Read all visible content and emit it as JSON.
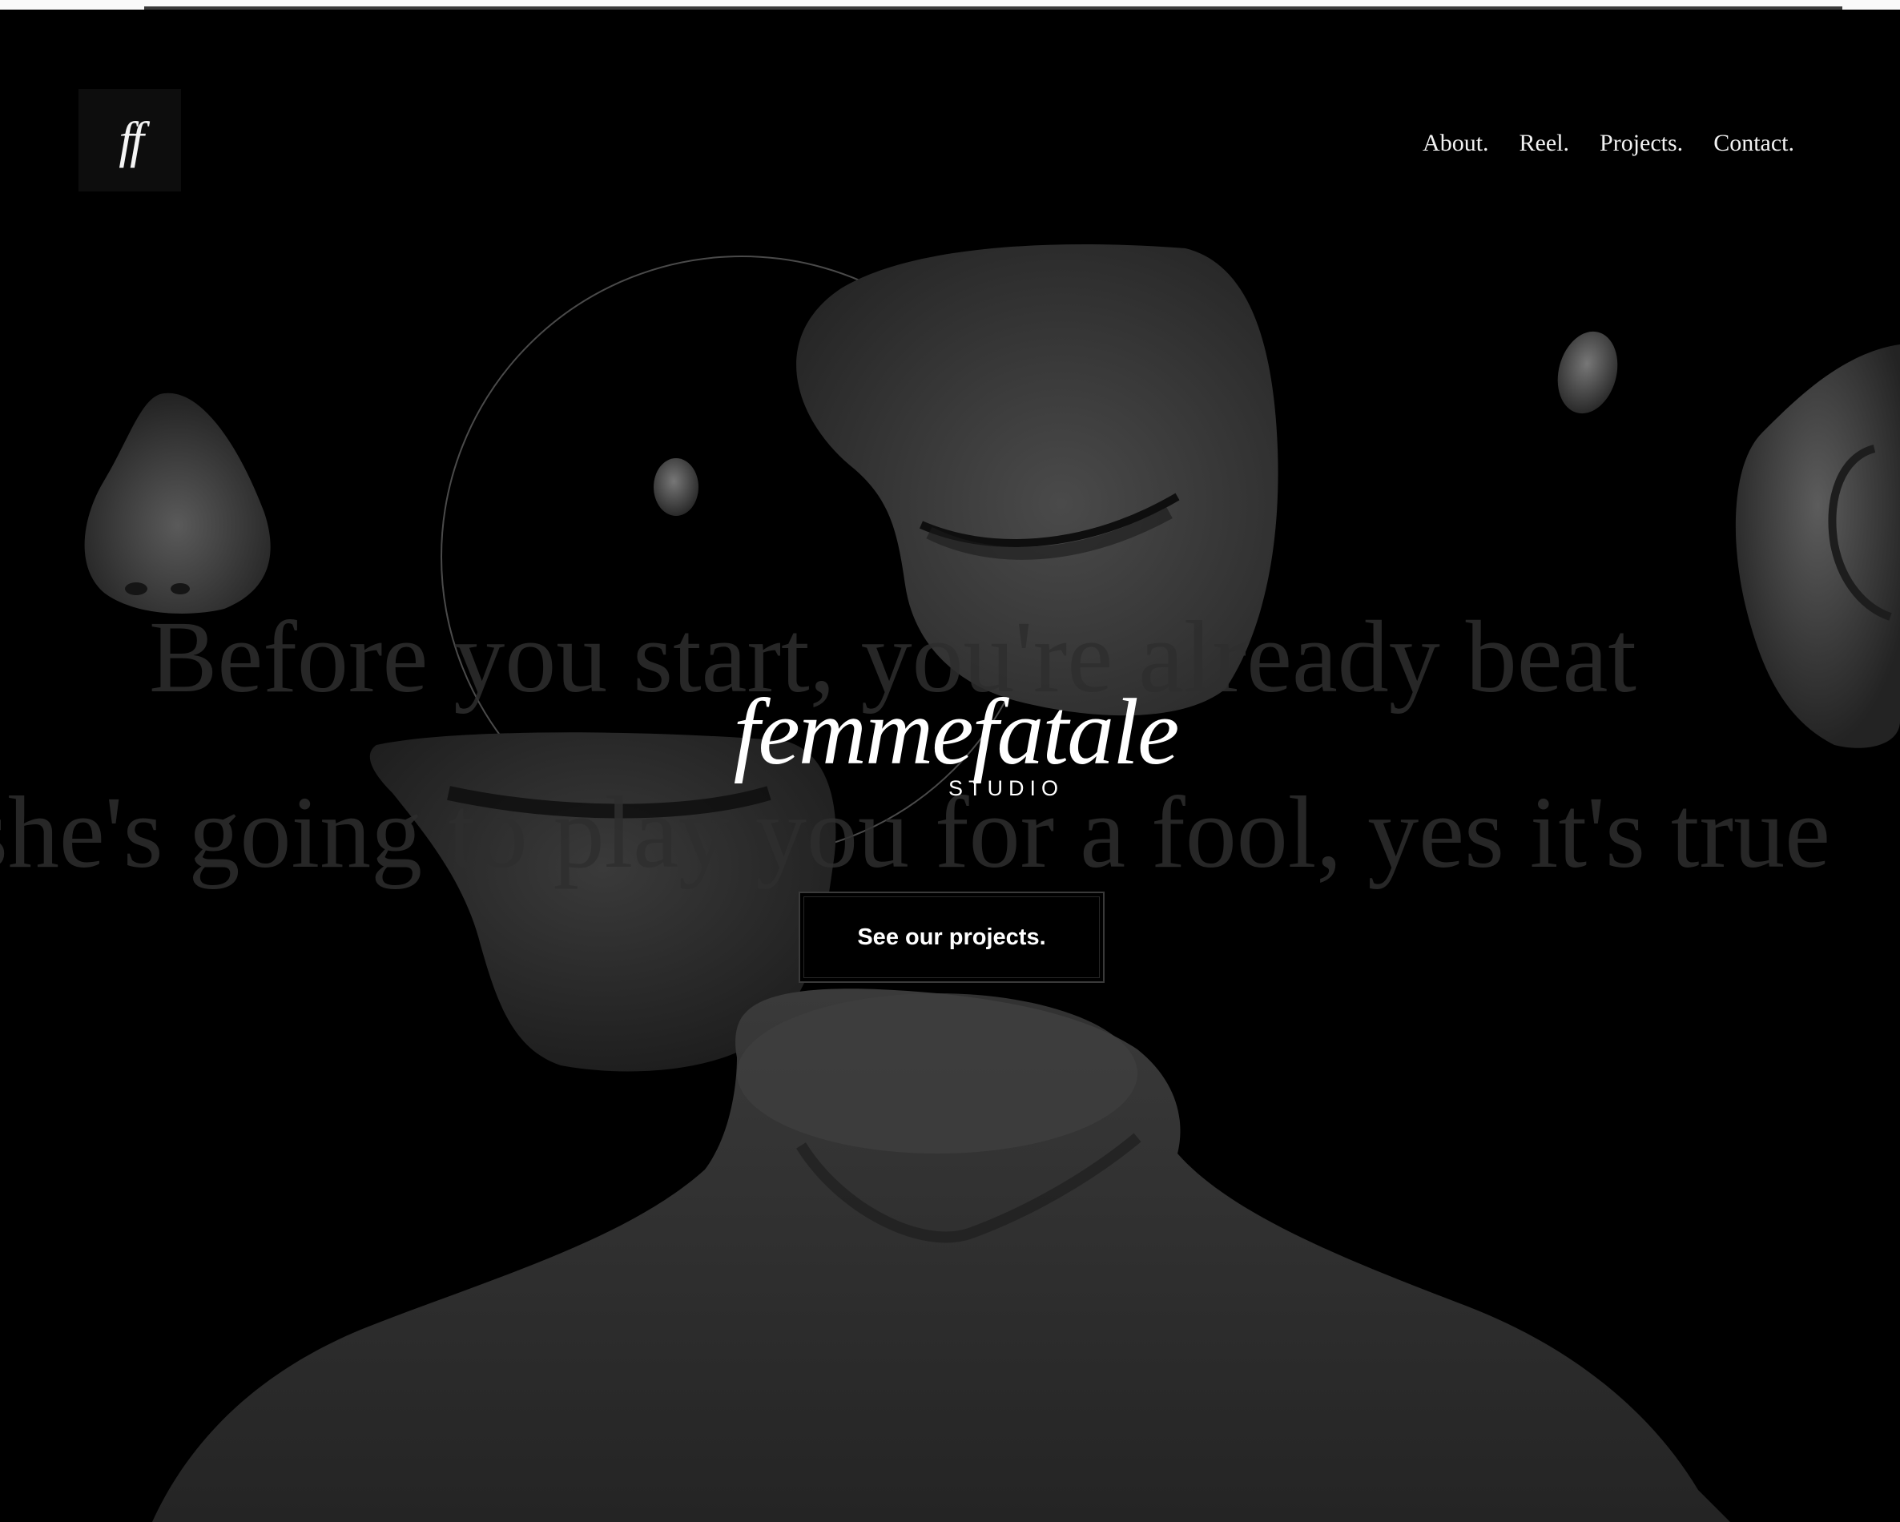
{
  "header": {
    "logo_text": "ff",
    "nav": [
      {
        "label": "About."
      },
      {
        "label": "Reel."
      },
      {
        "label": "Projects."
      },
      {
        "label": "Contact."
      }
    ]
  },
  "hero": {
    "marquee_line_1": "Before you start, you're already beat",
    "marquee_line_2": "she's going to play you for a fool, yes it's true",
    "brand_name": "femmefatale",
    "brand_sub": "STUDIO",
    "cta_label": "See our projects."
  },
  "colors": {
    "background": "#000000",
    "text": "#ffffff",
    "ghost_text": "#2e2e2e"
  },
  "icons": {
    "art_pieces": [
      "nose-sculpture",
      "eye-face-sculpture",
      "ear-sculpture",
      "lips-sculpture",
      "torso-sculpture",
      "small-stone"
    ]
  }
}
